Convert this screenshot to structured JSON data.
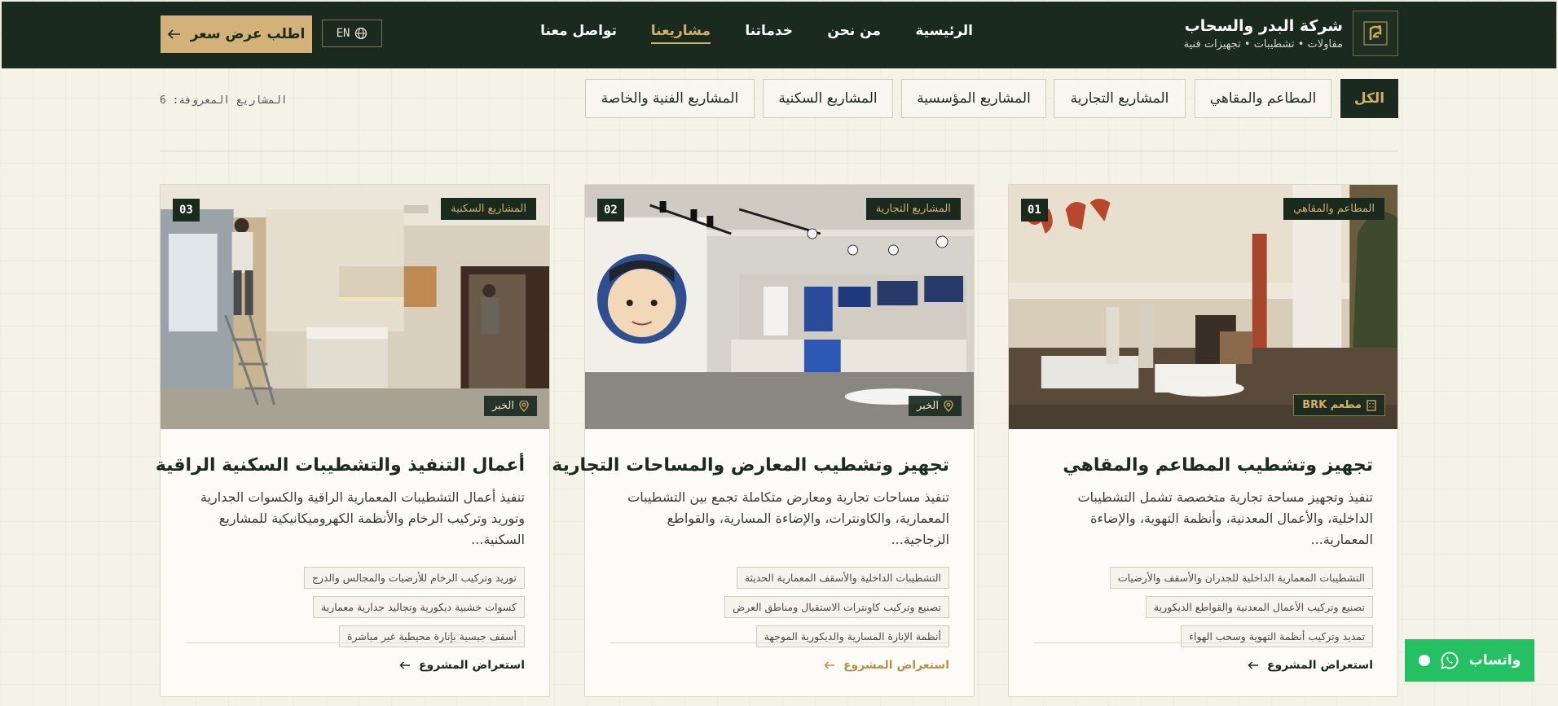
{
  "brand": {
    "name": "شركة البدر والسحاب",
    "tagline": "مقاولات • تشطيبات • تجهيزات فنية"
  },
  "nav": {
    "items": [
      {
        "label": "الرئيسية"
      },
      {
        "label": "من نحن"
      },
      {
        "label": "خدماتنا"
      },
      {
        "label": "مشاريعنا",
        "active": true
      },
      {
        "label": "تواصل معنا"
      }
    ],
    "lang": "EN",
    "quote": "اطلب عرض سعر"
  },
  "filters": [
    {
      "label": "الكل",
      "active": true
    },
    {
      "label": "المطاعم والمقاهي"
    },
    {
      "label": "المشاريع التجارية"
    },
    {
      "label": "المشاريع المؤسسية"
    },
    {
      "label": "المشاريع السكنية"
    },
    {
      "label": "المشاريع الفنية والخاصة"
    }
  ],
  "projects_count": "المشاريع المعروفة: 6",
  "cards": [
    {
      "num": "01",
      "category": "المطاعم والمقاهي",
      "location": "مطعم BRK",
      "title": "تجهيز وتشطيب المطاعم والمقاهي",
      "description": "تنفيذ وتجهيز مساحة تجارية متخصصة تشمل التشطيبات الداخلية، والأعمال المعدنية، وأنظمة التهوية، والإضاءة المعمارية...",
      "tags": [
        "التشطيبات المعمارية الداخلية للجدران والأسقف والأرضيات",
        "تصنيع وتركيب الأعمال المعدنية والقواطع الديكورية",
        "تمديد وتركيب أنظمة التهوية وسحب الهواء"
      ],
      "link": "استعراض المشروع"
    },
    {
      "num": "02",
      "category": "المشاريع التجارية",
      "location": "الخبر",
      "title": "تجهيز وتشطيب المعارض والمساحات التجارية",
      "description": "تنفيذ مساحات تجارية ومعارض متكاملة تجمع بين التشطيبات المعمارية، والكاونترات، والإضاءة المسارية، والقواطع الزجاجية...",
      "tags": [
        "التشطيبات الداخلية والأسقف المعمارية الحديثة",
        "تصنيع وتركيب كاونترات الاستقبال ومناطق العرض",
        "أنظمة الإنارة المسارية والديكورية الموجهة"
      ],
      "link": "استعراض المشروع"
    },
    {
      "num": "03",
      "category": "المشاريع السكنية",
      "location": "الخبر",
      "title": "أعمال التنفيذ والتشطيبات السكنية الراقية",
      "description": "تنفيذ أعمال التشطيبات المعمارية الراقية والكسوات الجدارية وتوريد وتركيب الرخام والأنظمة الكهروميكانيكية للمشاريع السكنية...",
      "tags": [
        "توريد وتركيب الرخام للأرضيات والمجالس والدرج",
        "كسوات خشبية ديكورية وتجاليد جدارية معمارية",
        "أسقف جبسية بإنارة محيطية غير مباشرة"
      ],
      "link": "استعراض المشروع"
    }
  ],
  "whatsapp": "واتساب",
  "colors": {
    "header_bg": "#1a2a1e",
    "accent_gold": "#d4af6a",
    "quote_button": "#d3b27a",
    "whatsapp_green": "#25c064",
    "page_bg": "#f5f2e8"
  },
  "icons": {
    "brand": "brand-logo-icon",
    "lang": "globe-icon",
    "arrow": "arrow-left-icon",
    "location": "map-pin-icon",
    "building": "building-icon",
    "whatsapp": "whatsapp-icon"
  }
}
